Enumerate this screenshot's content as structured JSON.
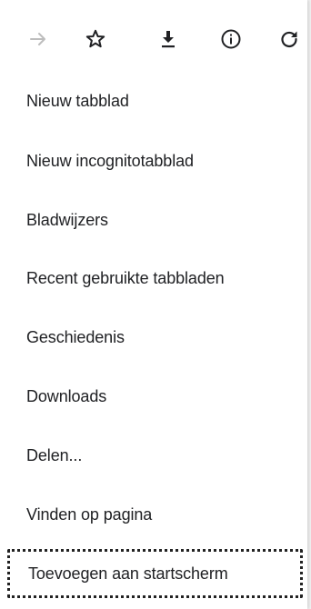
{
  "toolbar": {
    "buttons": [
      {
        "icon": "forward-arrow-icon",
        "enabled": false
      },
      {
        "icon": "star-outline-icon",
        "enabled": true
      },
      {
        "icon": "download-icon",
        "enabled": true
      },
      {
        "icon": "info-circle-icon",
        "enabled": true
      },
      {
        "icon": "reload-icon",
        "enabled": true
      }
    ]
  },
  "menu": {
    "items": [
      {
        "label": "Nieuw tabblad"
      },
      {
        "label": "Nieuw incognitotabblad"
      },
      {
        "label": "Bladwijzers"
      },
      {
        "label": "Recent gebruikte tabbladen"
      },
      {
        "label": "Geschiedenis"
      },
      {
        "label": "Downloads"
      },
      {
        "label": "Delen..."
      },
      {
        "label": "Vinden op pagina"
      },
      {
        "label": "Toevoegen aan startscherm",
        "highlighted": true
      }
    ]
  },
  "colors": {
    "text": "#202124",
    "icon": "#202124",
    "icon_disabled": "#bdbdbd",
    "background": "#ffffff",
    "highlight_border": "#222222"
  }
}
